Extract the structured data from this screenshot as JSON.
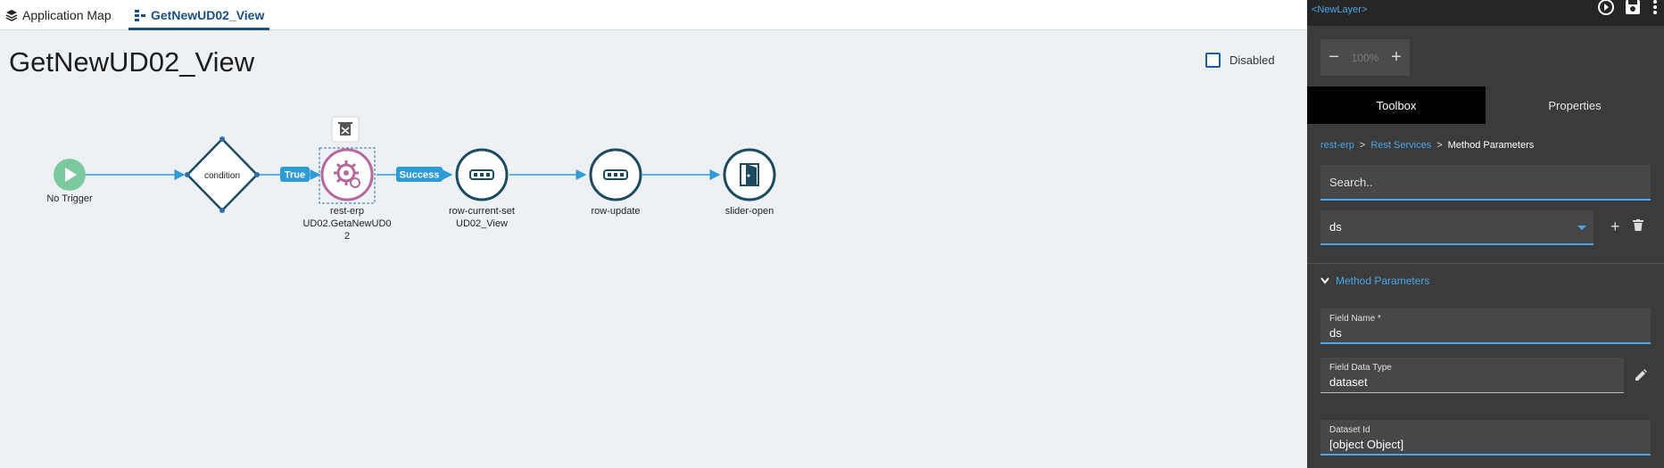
{
  "tabs": [
    {
      "label": "Application Map",
      "icon": "layers-icon",
      "active": false
    },
    {
      "label": "GetNewUD02_View",
      "icon": "flow-icon",
      "active": true
    }
  ],
  "canvas": {
    "title": "GetNewUD02_View",
    "disabled_label": "Disabled",
    "disabled_checked": false,
    "nodes": [
      {
        "id": "trigger",
        "label": "No Trigger",
        "icon": "play-icon"
      },
      {
        "id": "condition",
        "label": "condition",
        "icon": "diamond"
      },
      {
        "id": "rest",
        "label_lines": [
          "rest-erp",
          "UD02.GetaNewUD0",
          "2"
        ],
        "icon": "gear-refresh-icon"
      },
      {
        "id": "row-current-set",
        "label_lines": [
          "row-current-set",
          "UD02_View"
        ],
        "icon": "row-icon"
      },
      {
        "id": "row-update",
        "label": "row-update",
        "icon": "row-icon"
      },
      {
        "id": "slider-open",
        "label": "slider-open",
        "icon": "door-icon"
      }
    ],
    "edge_labels": {
      "true_label": "True",
      "success_label": "Success"
    },
    "colors": {
      "edge": "#2e9ad6",
      "node_border": "#1c4a5e",
      "rest_node": "#b4689b",
      "trigger": "#7cc9a0"
    }
  },
  "panel": {
    "layer_link": "<NewLayer>",
    "zoom": {
      "minus": "−",
      "value": "100%",
      "plus": "+"
    },
    "tabs": [
      {
        "label": "Toolbox",
        "active": true
      },
      {
        "label": "Properties",
        "active": false
      }
    ],
    "breadcrumb": {
      "items": [
        "rest-erp",
        "Rest Services"
      ],
      "separator": ">",
      "current": "Method Parameters"
    },
    "search": {
      "placeholder": "Search.."
    },
    "select": {
      "value": "ds",
      "add": "+"
    },
    "section": {
      "title": "Method Parameters"
    },
    "fields": [
      {
        "label": "Field Name *",
        "value": "ds"
      },
      {
        "label": "Field Data Type",
        "value": "dataset"
      },
      {
        "label": "Dataset Id",
        "value": "[object Object]"
      }
    ],
    "colors": {
      "accent": "#4aa6ea",
      "panel_bg": "#3b3b3b"
    }
  }
}
